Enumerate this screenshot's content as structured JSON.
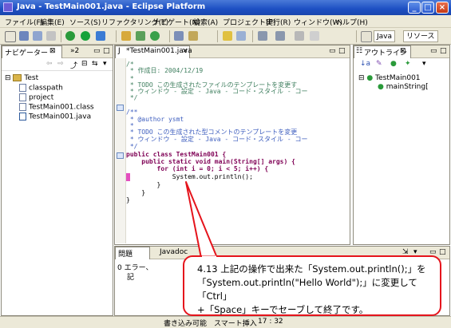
{
  "window": {
    "title": "Java - TestMain001.java - Eclipse Platform",
    "buttons": {
      "minimize": "_",
      "maximize": "□",
      "close": "×"
    }
  },
  "menubar": {
    "items": [
      "ファイル(F)",
      "編集(E)",
      "ソース(S)",
      "リファクタリング(T)",
      "ナビゲート(N)",
      "検索(A)",
      "プロジェクト(P)",
      "実行(R)",
      "ウィンドウ(W)",
      "ヘルプ(H)"
    ]
  },
  "perspectives": {
    "java": "Java",
    "resource": "リソース"
  },
  "navigator": {
    "tab_label": "ナビゲーター",
    "tab_close": "⊠",
    "tab_second": "»2",
    "items": [
      "Test",
      "classpath",
      "project",
      "TestMain001.class",
      "TestMain001.java"
    ]
  },
  "editor": {
    "tab_label": "*TestMain001.java",
    "tab_close": "×",
    "lines": [
      {
        "cls": "cmt",
        "text": "/*"
      },
      {
        "cls": "cmt",
        "text": " * 作成日: 2004/12/19"
      },
      {
        "cls": "cmt",
        "text": " *"
      },
      {
        "cls": "cmt",
        "text": " * TODO この生成されたファイルのテンプレートを変更す"
      },
      {
        "cls": "cmt",
        "text": " * ウィンドウ - 設定 - Java - コード・スタイル - コー"
      },
      {
        "cls": "cmt",
        "text": " */"
      },
      {
        "cls": "",
        "text": ""
      },
      {
        "cls": "doc",
        "text": "/**"
      },
      {
        "cls": "doc",
        "text": " * @author ysmt"
      },
      {
        "cls": "doc",
        "text": " *"
      },
      {
        "cls": "doc",
        "text": " * TODO この生成された型コメントのテンプレートを変更"
      },
      {
        "cls": "doc",
        "text": " * ウィンドウ - 設定 - Java - コード・スタイル - コー"
      },
      {
        "cls": "doc",
        "text": " */"
      },
      {
        "cls": "",
        "text": "public class TestMain001 {"
      },
      {
        "cls": "",
        "text": "    public static void main(String[] args) {"
      },
      {
        "cls": "",
        "text": "        for (int i = 0; i < 5; i++) {"
      },
      {
        "cls": "",
        "text": "            System.out.println();"
      },
      {
        "cls": "",
        "text": "        }"
      },
      {
        "cls": "",
        "text": "    }"
      },
      {
        "cls": "",
        "text": "}"
      }
    ]
  },
  "outline": {
    "tab_label": "アウトライン",
    "tab_close": "⊠",
    "items": [
      "TestMain001",
      "mainString["
    ]
  },
  "bottom_panel": {
    "tabs": [
      "問題",
      "Javadoc"
    ],
    "status_text": "0 エラー、",
    "column_hint": "記"
  },
  "statusbar": {
    "items": [
      "書き込み可能",
      "スマート挿入",
      "17 : 32"
    ]
  },
  "callout": {
    "lines": [
      "4.13 上記の操作で出来た「System.out.println();」を",
      "「System.out.println(\"Hello World\");」に変更して「Ctrl」",
      "+「Space」キーでセーブして終了です。"
    ]
  }
}
